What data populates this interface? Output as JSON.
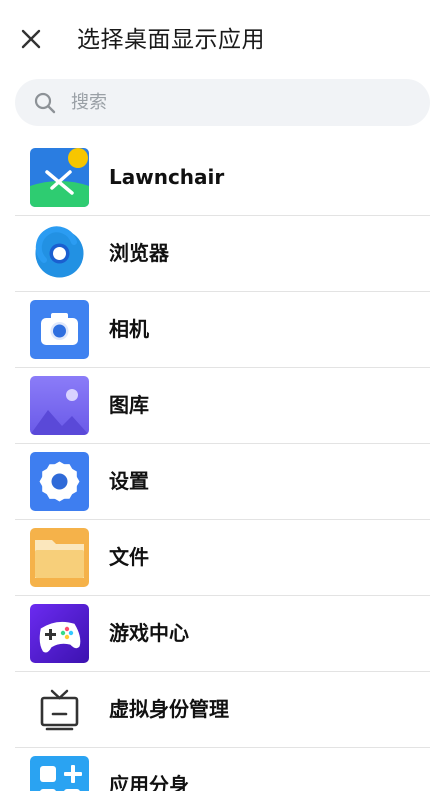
{
  "header": {
    "title": "选择桌面显示应用",
    "close_icon": "close-icon"
  },
  "search": {
    "placeholder": "搜索",
    "value": "",
    "icon": "search-icon"
  },
  "apps": [
    {
      "label": "Lawnchair",
      "icon": "lawnchair-icon",
      "accent": "#2bc46b"
    },
    {
      "label": "浏览器",
      "icon": "browser-icon",
      "accent": "#1e88e5"
    },
    {
      "label": "相机",
      "icon": "camera-icon",
      "accent": "#3f82f0"
    },
    {
      "label": "图库",
      "icon": "gallery-icon",
      "accent": "#7b6cf5"
    },
    {
      "label": "设置",
      "icon": "settings-icon",
      "accent": "#3e7ef0"
    },
    {
      "label": "文件",
      "icon": "folder-icon",
      "accent": "#f5b24a"
    },
    {
      "label": "游戏中心",
      "icon": "game-center-icon",
      "accent": "#5a22d8"
    },
    {
      "label": "虚拟身份管理",
      "icon": "tv-icon",
      "accent": "#333333"
    },
    {
      "label": "应用分身",
      "icon": "app-clone-icon",
      "accent": "#2aa3f2"
    }
  ]
}
